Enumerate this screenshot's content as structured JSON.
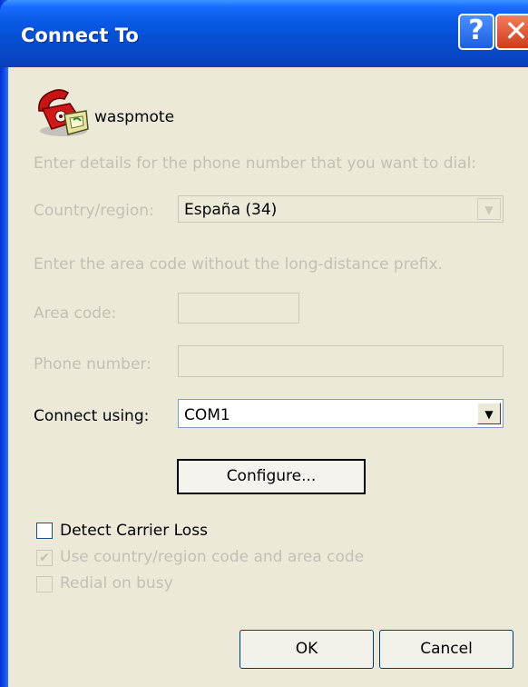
{
  "window": {
    "title": "Connect To",
    "help_label": "?",
    "close_label": "✕"
  },
  "connection": {
    "name": "waspmote",
    "icon": "phone-connection-icon"
  },
  "form": {
    "instruction_dial": "Enter details for the phone number that you want to dial:",
    "country_label": "Country/region:",
    "country_value": "España (34)",
    "instruction_area": "Enter the area code without the long-distance prefix.",
    "area_code_label": "Area code:",
    "area_code_value": "",
    "phone_label": "Phone number:",
    "phone_value": "",
    "connect_using_label": "Connect using:",
    "connect_using_value": "COM1",
    "configure_label": "Configure..."
  },
  "options": {
    "detect_carrier_loss": "Detect Carrier Loss",
    "use_country_code": "Use country/region code and area code",
    "redial_on_busy": "Redial on busy"
  },
  "buttons": {
    "ok": "OK",
    "cancel": "Cancel"
  },
  "colors": {
    "titlebar": "#0a5ae8",
    "dialog_bg": "#ece9d8",
    "disabled_text": "#c2c0b4"
  }
}
